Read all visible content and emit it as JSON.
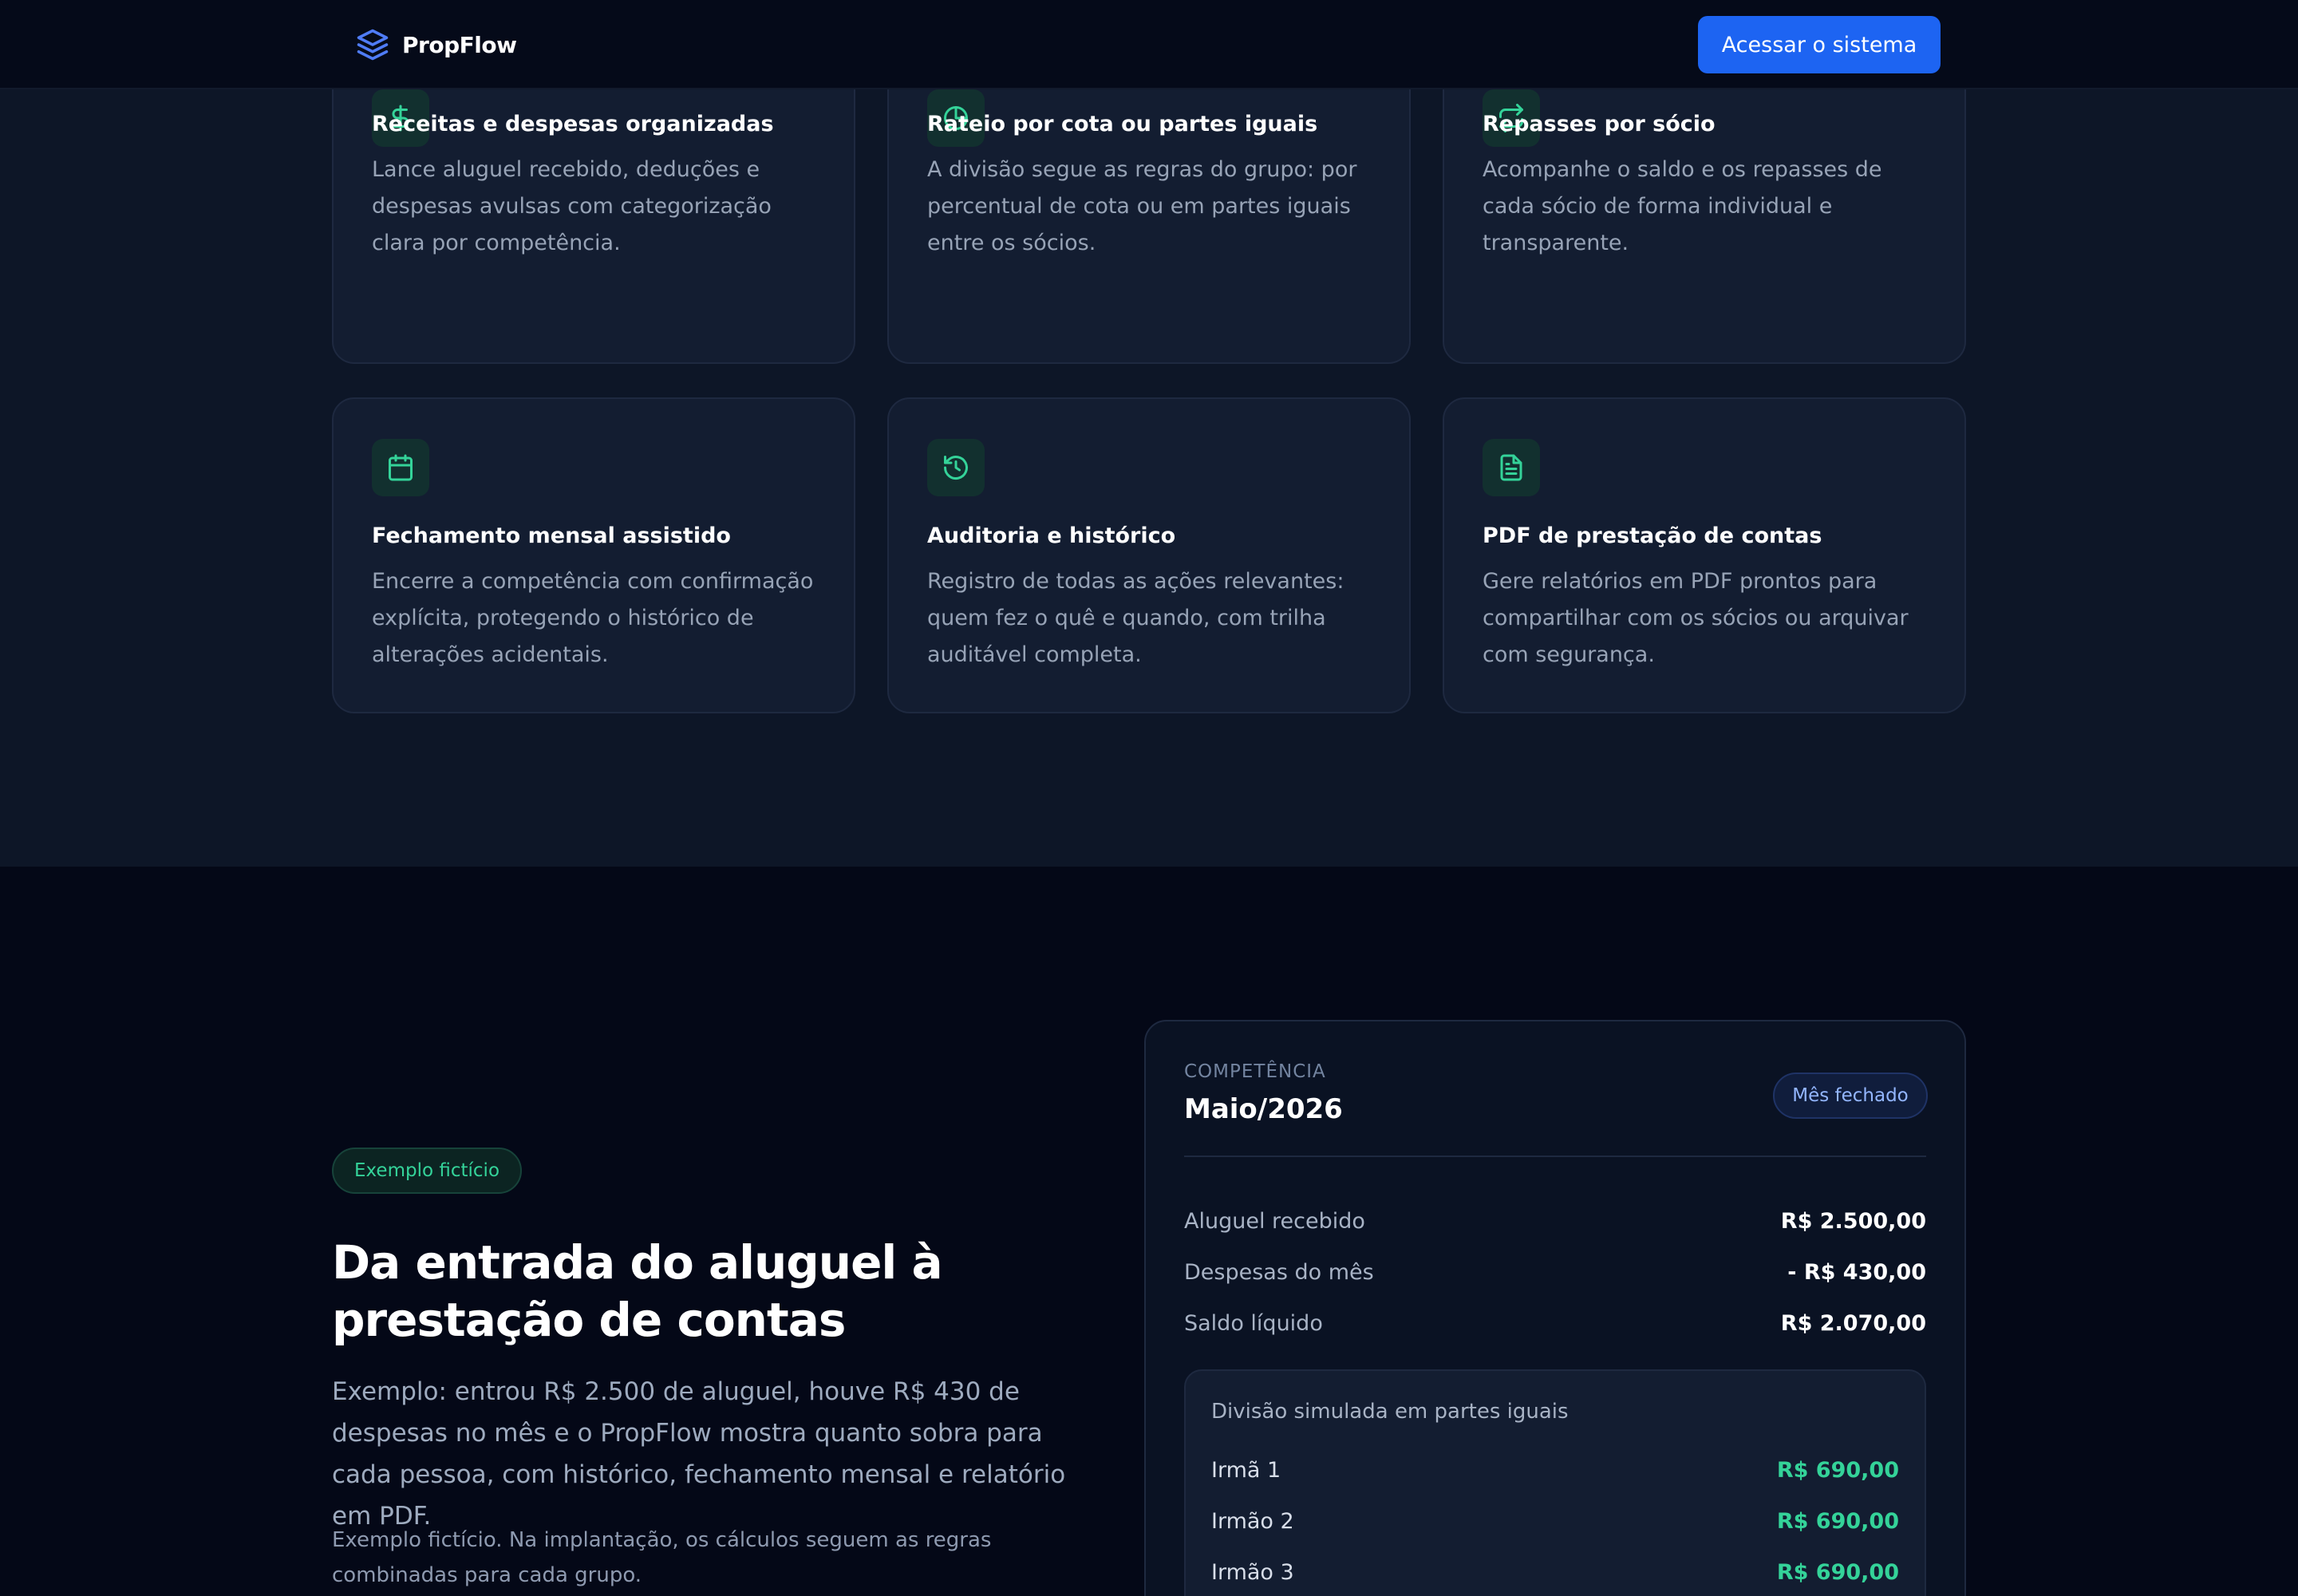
{
  "nav": {
    "brand": "PropFlow",
    "cta_label": "Acessar o sistema"
  },
  "features": [
    {
      "icon": "dollar-icon",
      "title": "Receitas e despesas organizadas",
      "description": "Lance aluguel recebido, deduções e despesas avulsas com categorização clara por competência."
    },
    {
      "icon": "pie-chart-icon",
      "title": "Rateio por cota ou partes iguais",
      "description": "A divisão segue as regras do grupo: por percentual de cota ou em partes iguais entre os sócios."
    },
    {
      "icon": "repeat-icon",
      "title": "Repasses por sócio",
      "description": "Acompanhe o saldo e os repasses de cada sócio de forma individual e transparente."
    },
    {
      "icon": "calendar-icon",
      "title": "Fechamento mensal assistido",
      "description": "Encerre a competência com confirmação explícita, protegendo o histórico de alterações acidentais."
    },
    {
      "icon": "history-icon",
      "title": "Auditoria e histórico",
      "description": "Registro de todas as ações relevantes: quem fez o quê e quando, com trilha auditável completa."
    },
    {
      "icon": "file-text-icon",
      "title": "PDF de prestação de contas",
      "description": "Gere relatórios em PDF prontos para compartilhar com os sócios ou arquivar com segurança."
    }
  ],
  "example": {
    "badge": "Exemplo fictício",
    "title": "Da entrada do aluguel à prestação de contas",
    "description": "Exemplo: entrou R$ 2.500 de aluguel, houve R$ 430 de despesas no mês e o PropFlow mostra quanto sobra para cada pessoa, com histórico, fechamento mensal e relatório em PDF.",
    "note": "Exemplo fictício. Na implantação, os cálculos seguem as regras combinadas para cada grupo."
  },
  "panel": {
    "competence_label": "COMPETÊNCIA",
    "competence_value": "Maio/2026",
    "status": "Mês fechado",
    "lines": [
      {
        "label": "Aluguel recebido",
        "value": "R$ 2.500,00"
      },
      {
        "label": "Despesas do mês",
        "value": "- R$ 430,00"
      },
      {
        "label": "Saldo líquido",
        "value": "R$ 2.070,00"
      }
    ],
    "split_title": "Divisão simulada em partes iguais",
    "split": [
      {
        "name": "Irmã 1",
        "amount": "R$ 690,00"
      },
      {
        "name": "Irmão 2",
        "amount": "R$ 690,00"
      },
      {
        "name": "Irmão 3",
        "amount": "R$ 690,00"
      }
    ]
  },
  "colors": {
    "accent_blue": "#1d64f2",
    "accent_green": "#34d399",
    "background": "#040817",
    "card": "#131d31"
  }
}
